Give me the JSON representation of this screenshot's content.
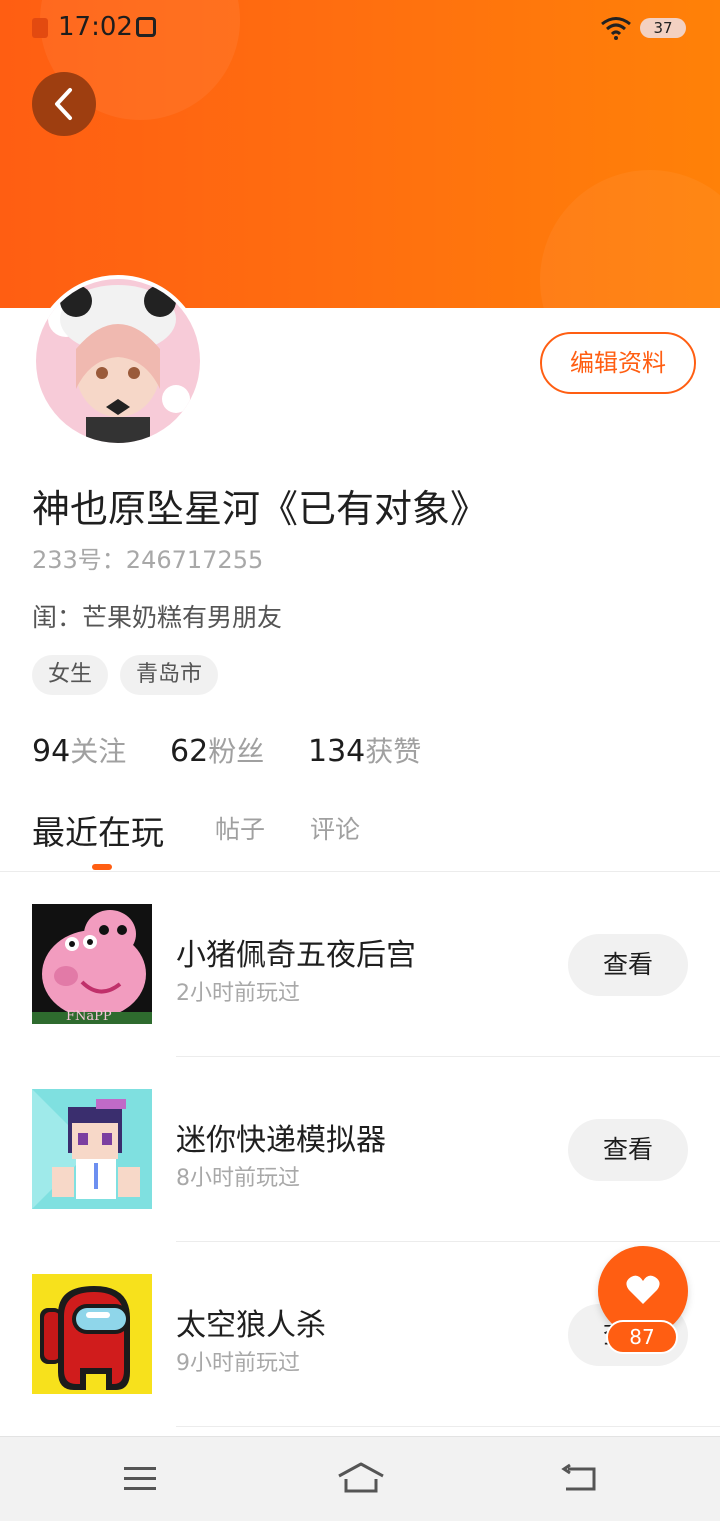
{
  "status_bar": {
    "time": "17:02",
    "battery": "37"
  },
  "profile": {
    "edit_label": "编辑资料",
    "username": "神也原坠星河《已有对象》",
    "uid": "233号：246717255",
    "bio": "闺：芒果奶糕有男朋友",
    "tags": [
      "女生",
      "青岛市"
    ],
    "stats": [
      {
        "num": "94",
        "label": "关注"
      },
      {
        "num": "62",
        "label": "粉丝"
      },
      {
        "num": "134",
        "label": "获赞"
      }
    ]
  },
  "tabs": [
    {
      "label": "最近在玩",
      "active": true
    },
    {
      "label": "帖子",
      "active": false
    },
    {
      "label": "评论",
      "active": false
    }
  ],
  "games": [
    {
      "name": "小猪佩奇五夜后宫",
      "time": "2小时前玩过",
      "button": "查看",
      "thumb_text": "FNaPP"
    },
    {
      "name": "迷你快递模拟器",
      "time": "8小时前玩过",
      "button": "查看"
    },
    {
      "name": "太空狼人杀",
      "time": "9小时前玩过",
      "button": "查看"
    }
  ],
  "fab": {
    "count": "87"
  },
  "colors": {
    "accent": "#ff5e12",
    "banner_end": "#ff8108"
  }
}
